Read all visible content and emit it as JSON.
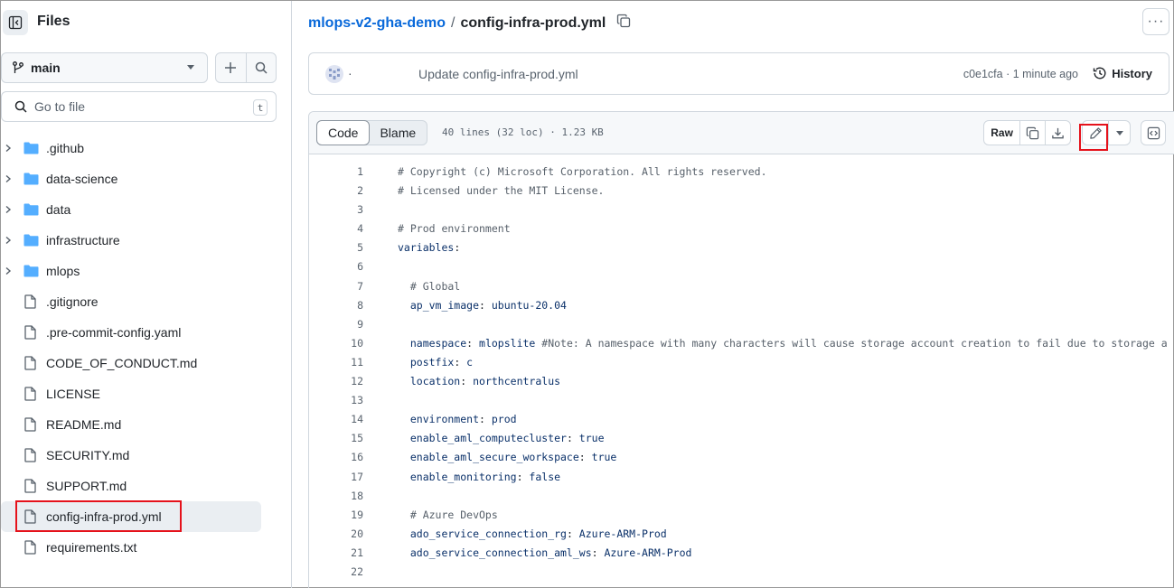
{
  "sidebar": {
    "title": "Files",
    "branch": "main",
    "goto_placeholder": "Go to file",
    "goto_shortcut": "t",
    "items": [
      {
        "name": ".github",
        "type": "folder"
      },
      {
        "name": "data-science",
        "type": "folder"
      },
      {
        "name": "data",
        "type": "folder"
      },
      {
        "name": "infrastructure",
        "type": "folder"
      },
      {
        "name": "mlops",
        "type": "folder"
      },
      {
        "name": ".gitignore",
        "type": "file"
      },
      {
        "name": ".pre-commit-config.yaml",
        "type": "file"
      },
      {
        "name": "CODE_OF_CONDUCT.md",
        "type": "file"
      },
      {
        "name": "LICENSE",
        "type": "file"
      },
      {
        "name": "README.md",
        "type": "file"
      },
      {
        "name": "SECURITY.md",
        "type": "file"
      },
      {
        "name": "SUPPORT.md",
        "type": "file"
      },
      {
        "name": "config-infra-prod.yml",
        "type": "file",
        "selected": true
      },
      {
        "name": "requirements.txt",
        "type": "file"
      }
    ]
  },
  "breadcrumb": {
    "repo": "mlops-v2-gha-demo",
    "separator": "/",
    "file": "config-infra-prod.yml"
  },
  "commit": {
    "author": "·",
    "message": "Update config-infra-prod.yml",
    "meta": "c0e1cfa · 1 minute ago",
    "history_label": "History"
  },
  "file_header": {
    "code_tab": "Code",
    "blame_tab": "Blame",
    "info": "40 lines (32 loc) · 1.23 KB",
    "raw_label": "Raw"
  },
  "code_lines": [
    {
      "n": "1",
      "parts": [
        [
          "c-com",
          "# Copyright (c) Microsoft Corporation. All rights reserved."
        ]
      ]
    },
    {
      "n": "2",
      "parts": [
        [
          "c-com",
          "# Licensed under the MIT License."
        ]
      ]
    },
    {
      "n": "3",
      "parts": []
    },
    {
      "n": "4",
      "parts": [
        [
          "c-com",
          "# Prod environment"
        ]
      ]
    },
    {
      "n": "5",
      "parts": [
        [
          "c-key",
          "variables"
        ],
        [
          "",
          ":"
        ]
      ]
    },
    {
      "n": "6",
      "parts": []
    },
    {
      "n": "7",
      "parts": [
        [
          "c-com",
          "  # Global"
        ]
      ]
    },
    {
      "n": "8",
      "parts": [
        [
          "c-key",
          "  ap_vm_image"
        ],
        [
          "",
          ": "
        ],
        [
          "c-val",
          "ubuntu-20.04"
        ]
      ]
    },
    {
      "n": "9",
      "parts": []
    },
    {
      "n": "10",
      "parts": [
        [
          "c-key",
          "  namespace"
        ],
        [
          "",
          ": "
        ],
        [
          "c-val",
          "mlopslite "
        ],
        [
          "c-com",
          "#Note: A namespace with many characters will cause storage account creation to fail due to storage a"
        ]
      ]
    },
    {
      "n": "11",
      "parts": [
        [
          "c-key",
          "  postfix"
        ],
        [
          "",
          ": "
        ],
        [
          "c-val",
          "c"
        ]
      ]
    },
    {
      "n": "12",
      "parts": [
        [
          "c-key",
          "  location"
        ],
        [
          "",
          ": "
        ],
        [
          "c-val",
          "northcentralus"
        ]
      ]
    },
    {
      "n": "13",
      "parts": []
    },
    {
      "n": "14",
      "parts": [
        [
          "c-key",
          "  environment"
        ],
        [
          "",
          ": "
        ],
        [
          "c-val",
          "prod"
        ]
      ]
    },
    {
      "n": "15",
      "parts": [
        [
          "c-key",
          "  enable_aml_computecluster"
        ],
        [
          "",
          ": "
        ],
        [
          "c-val",
          "true"
        ]
      ]
    },
    {
      "n": "16",
      "parts": [
        [
          "c-key",
          "  enable_aml_secure_workspace"
        ],
        [
          "",
          ": "
        ],
        [
          "c-val",
          "true"
        ]
      ]
    },
    {
      "n": "17",
      "parts": [
        [
          "c-key",
          "  enable_monitoring"
        ],
        [
          "",
          ": "
        ],
        [
          "c-val",
          "false"
        ]
      ]
    },
    {
      "n": "18",
      "parts": []
    },
    {
      "n": "19",
      "parts": [
        [
          "c-com",
          "  # Azure DevOps"
        ]
      ]
    },
    {
      "n": "20",
      "parts": [
        [
          "c-key",
          "  ado_service_connection_rg"
        ],
        [
          "",
          ": "
        ],
        [
          "c-val",
          "Azure-ARM-Prod"
        ]
      ]
    },
    {
      "n": "21",
      "parts": [
        [
          "c-key",
          "  ado_service_connection_aml_ws"
        ],
        [
          "",
          ": "
        ],
        [
          "c-val",
          "Azure-ARM-Prod"
        ]
      ]
    },
    {
      "n": "22",
      "parts": []
    }
  ],
  "colors": {
    "link": "#0969da",
    "folder": "#54aeff",
    "highlight_box": "#e5121b",
    "selected_row": "#eaeef2"
  }
}
